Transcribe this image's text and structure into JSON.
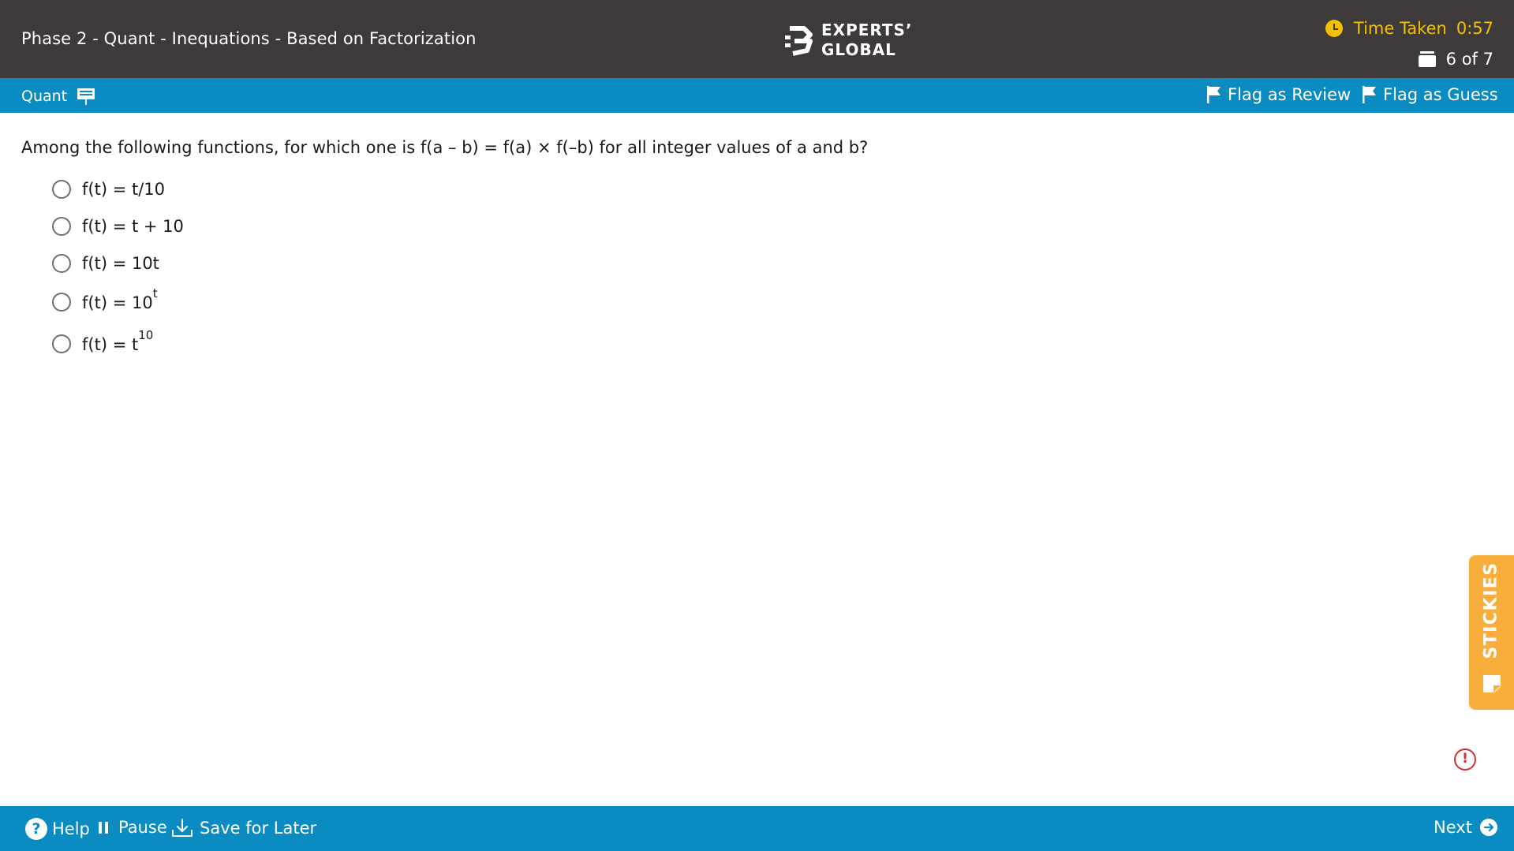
{
  "header": {
    "title": "Phase 2 - Quant - Inequations - Based on Factorization",
    "logo_line1": "EXPERTS’",
    "logo_line2": "GLOBAL",
    "timer_label": "Time Taken",
    "timer_value": "0:57",
    "progress": "6 of 7",
    "accent_color": "#f2c200",
    "background_color": "#3d3a39"
  },
  "subbar": {
    "section": "Quant",
    "flag_review": "Flag as Review",
    "flag_guess": "Flag as Guess",
    "background_color": "#0a8cc2"
  },
  "question": {
    "text": "Among the following functions, for which one is f(a – b) = f(a) × f(–b)  for all integer values of a and b?",
    "options": [
      {
        "text": "f(t) = t/10"
      },
      {
        "text": "f(t) = t + 10"
      },
      {
        "text": "f(t) = 10t"
      },
      {
        "base": "f(t) = 10",
        "sup": "t"
      },
      {
        "base": "f(t) = t",
        "sup": "10"
      }
    ]
  },
  "stickies": {
    "label": "STICKIES",
    "color": "#f9ae3c"
  },
  "alert": {
    "symbol": "!",
    "color": "#d32f2f"
  },
  "footer": {
    "help": "Help",
    "pause": "Pause",
    "save_for_later": "Save for Later",
    "next": "Next"
  }
}
